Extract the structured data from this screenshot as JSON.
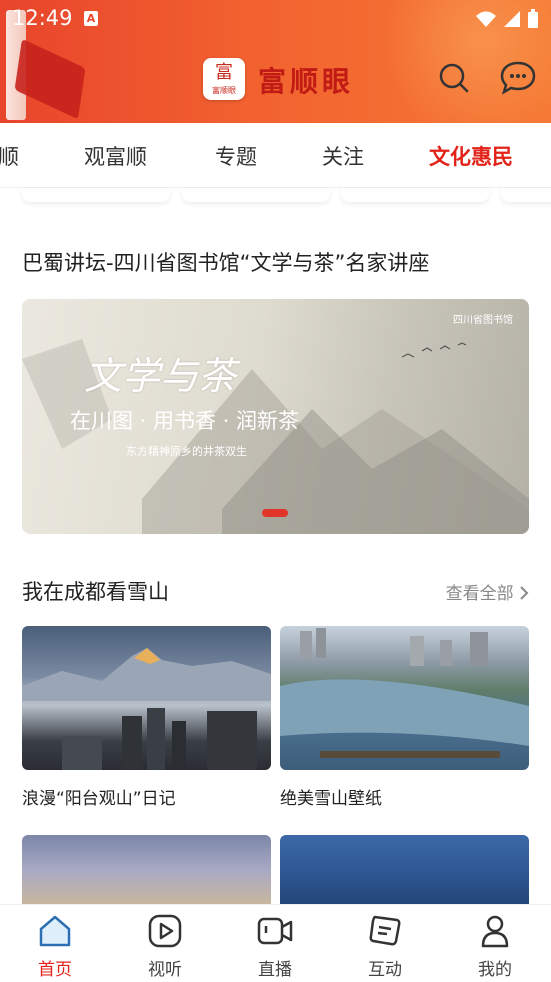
{
  "status": {
    "time": "12:49",
    "a_badge": "A"
  },
  "header": {
    "brand": "富顺眼",
    "logo_mark": "富",
    "logo_small": "富顺眼"
  },
  "tabs": [
    "顺",
    "观富顺",
    "专题",
    "关注",
    "文化惠民"
  ],
  "active_tab": "文化惠民",
  "section1": {
    "title": "巴蜀讲坛-四川省图书馆“文学与茶”名家讲座"
  },
  "banner": {
    "title": "文学与茶",
    "subtitle": "在川图 · 用书香 · 润新茶",
    "tagline": "东方精神原乡的井茶双生",
    "org": "四川省图书馆"
  },
  "section2": {
    "title": "我在成都看雪山",
    "more_label": "查看全部"
  },
  "items": [
    {
      "caption": "浪漫“阳台观山”日记"
    },
    {
      "caption": "绝美雪山壁纸"
    }
  ],
  "bottom_nav": [
    {
      "label": "首页",
      "icon": "home-icon"
    },
    {
      "label": "视听",
      "icon": "play-icon"
    },
    {
      "label": "直播",
      "icon": "video-camera-icon"
    },
    {
      "label": "互动",
      "icon": "chat-card-icon"
    },
    {
      "label": "我的",
      "icon": "user-icon"
    }
  ],
  "colors": {
    "accent": "#e2231a",
    "header": "#f2612f"
  }
}
